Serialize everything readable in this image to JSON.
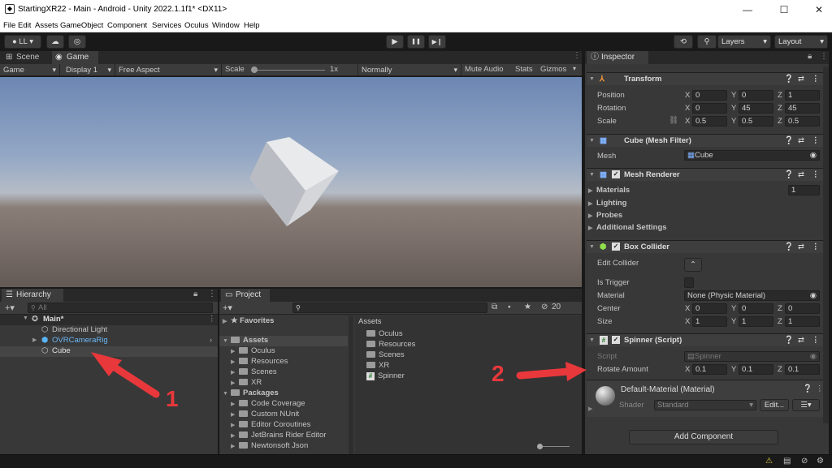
{
  "window": {
    "title": "StartingXR22 - Main - Android - Unity 2022.1.1f1* <DX11>",
    "min": "—",
    "max": "☐",
    "close": "✕"
  },
  "menu": [
    "File",
    "Edit",
    "Assets",
    "GameObject",
    "Component",
    "Services",
    "Oculus",
    "Window",
    "Help"
  ],
  "toolbar": {
    "account": "LL",
    "play": "▶",
    "pause": "❚❚",
    "step": "▶❙",
    "layers": "Layers",
    "layout": "Layout"
  },
  "scene_tabs": {
    "scene": "Scene",
    "game": "Game"
  },
  "game_bar": {
    "display": "Game",
    "display_num": "Display 1",
    "aspect": "Free Aspect",
    "scale_label": "Scale",
    "scale_value": "1x",
    "quality": "Normally",
    "mute": "Mute Audio",
    "stats": "Stats",
    "gizmos": "Gizmos"
  },
  "hierarchy": {
    "tab": "Hierarchy",
    "search": "All",
    "scene": "Main*",
    "items": [
      "Directional Light",
      "OVRCameraRig",
      "Cube"
    ]
  },
  "project": {
    "tab": "Project",
    "badge": "20",
    "favorites": "Favorites",
    "assets": "Assets",
    "asset_children": [
      "Oculus",
      "Resources",
      "Scenes",
      "XR"
    ],
    "packages": "Packages",
    "package_children": [
      "Code Coverage",
      "Custom NUnit",
      "Editor Coroutines",
      "JetBrains Rider Editor",
      "Newtonsoft Json"
    ],
    "grid_header": "Assets",
    "grid_items": [
      "Oculus",
      "Resources",
      "Scenes",
      "XR",
      "Spinner"
    ]
  },
  "inspector": {
    "tab": "Inspector",
    "transform": {
      "title": "Transform",
      "position": {
        "label": "Position",
        "x": "0",
        "y": "0",
        "z": "1"
      },
      "rotation": {
        "label": "Rotation",
        "x": "0",
        "y": "45",
        "z": "45"
      },
      "scale": {
        "label": "Scale",
        "x": "0.5",
        "y": "0.5",
        "z": "0.5"
      }
    },
    "mesh_filter": {
      "title": "Cube (Mesh Filter)",
      "mesh_label": "Mesh",
      "mesh_value": "Cube"
    },
    "mesh_renderer": {
      "title": "Mesh Renderer",
      "materials": "Materials",
      "materials_count": "1",
      "lighting": "Lighting",
      "probes": "Probes",
      "additional": "Additional Settings"
    },
    "box_collider": {
      "title": "Box Collider",
      "edit_collider": "Edit Collider",
      "is_trigger": "Is Trigger",
      "material_label": "Material",
      "material_value": "None (Physic Material)",
      "center": {
        "label": "Center",
        "x": "0",
        "y": "0",
        "z": "0"
      },
      "size": {
        "label": "Size",
        "x": "1",
        "y": "1",
        "z": "1"
      }
    },
    "spinner": {
      "title": "Spinner (Script)",
      "script_label": "Script",
      "script_value": "Spinner",
      "rotate_label": "Rotate Amount",
      "x": "0.1",
      "y": "0.1",
      "z": "0.1"
    },
    "material": {
      "title": "Default-Material (Material)",
      "shader_label": "Shader",
      "shader_value": "Standard",
      "edit": "Edit..."
    },
    "add_component": "Add Component"
  },
  "annotations": {
    "one": "1",
    "two": "2",
    "arrow_color": "#e8383b"
  }
}
